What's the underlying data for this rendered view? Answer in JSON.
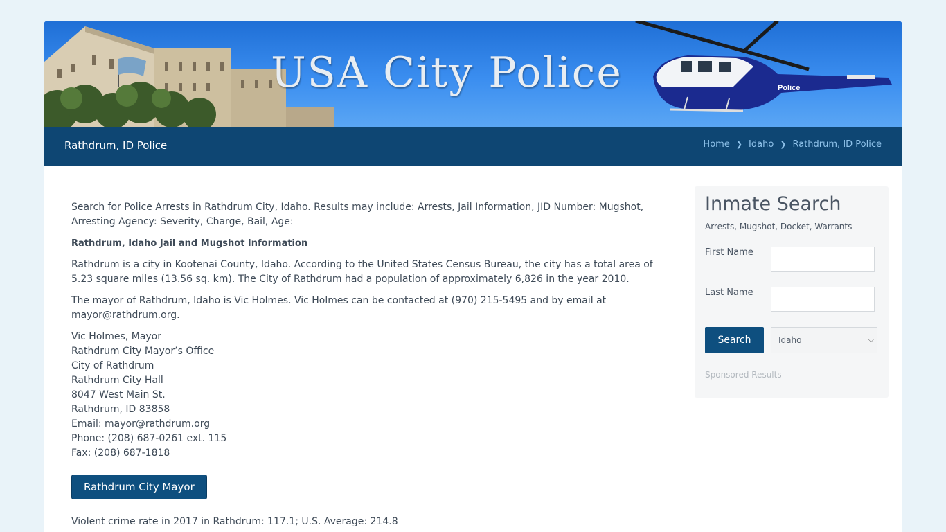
{
  "banner": {
    "title": "USA City Police",
    "heli_text": "Police"
  },
  "navbar": {
    "title": "Rathdrum, ID Police",
    "breadcrumb": [
      "Home",
      "Idaho",
      "Rathdrum, ID Police"
    ]
  },
  "content": {
    "intro": "Search for Police Arrests in Rathdrum City, Idaho. Results may include: Arrests, Jail Information, JID Number: Mugshot, Arresting Agency: Severity, Charge, Bail, Age:",
    "heading": "Rathdrum, Idaho Jail and Mugshot Information",
    "para1": "Rathdrum is a city in Kootenai County, Idaho. According to the United States Census Bureau, the city has a total area of 5.23 square miles (13.56 sq. km). The City of Rathdrum had a population of approximately 6,826 in the year 2010.",
    "para2": "The mayor of Rathdrum, Idaho is Vic Holmes. Vic Holmes can be contacted at (970) 215-5495 and by email at mayor@rathdrum.org.",
    "address": [
      "Vic Holmes, Mayor",
      "Rathdrum City Mayor’s Office",
      "City of Rathdrum",
      "Rathdrum City Hall",
      "8047 West Main St.",
      "Rathdrum, ID 83858",
      "Email: mayor@rathdrum.org",
      "Phone: (208) 687-0261 ext. 115",
      "Fax: (208) 687-1818"
    ],
    "mayor_button": "Rathdrum City Mayor",
    "crime": "Violent crime rate in 2017 in Rathdrum: 117.1; U.S. Average: 214.8"
  },
  "sidebar": {
    "title": "Inmate Search",
    "subtitle": "Arrests, Mugshot, Docket, Warrants",
    "first_name_label": "First Name",
    "last_name_label": "Last Name",
    "search_button": "Search",
    "state_selected": "Idaho",
    "sponsored": "Sponsored Results"
  },
  "colors": {
    "navbar": "#0e4673",
    "button": "#0e4f7f",
    "page_bg": "#e9f3f9"
  }
}
